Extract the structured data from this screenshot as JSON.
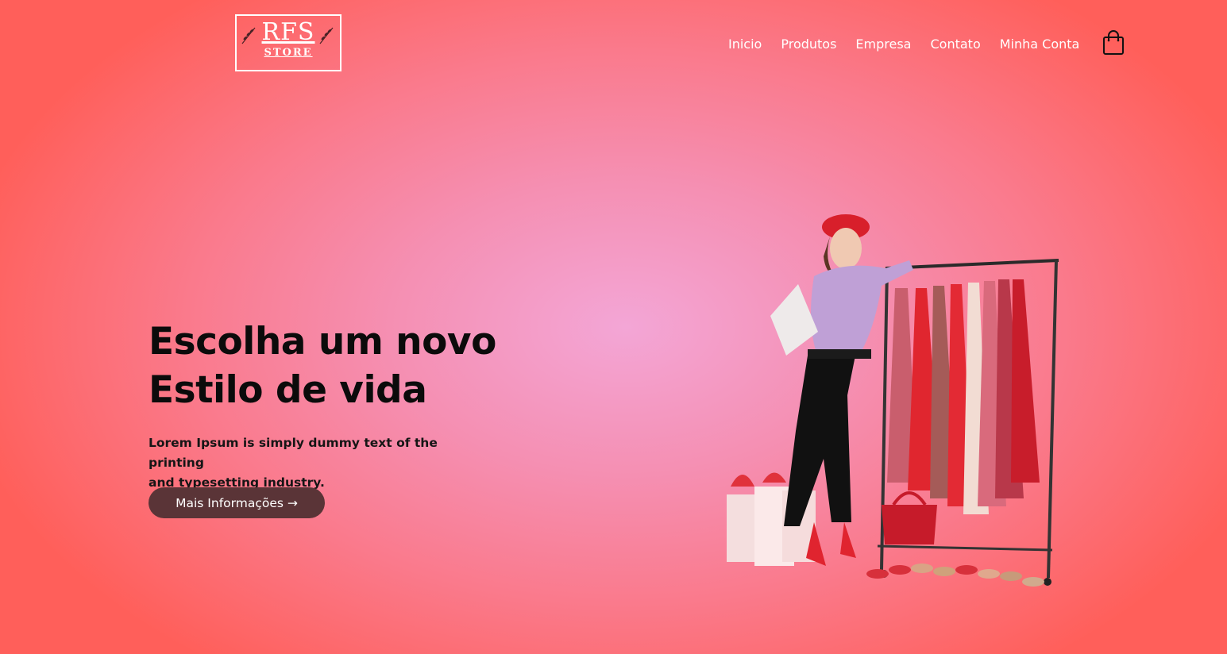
{
  "brand": {
    "logo_main": "RFS",
    "logo_sub": "STORE"
  },
  "nav": {
    "items": [
      "Inicio",
      "Produtos",
      "Empresa",
      "Contato",
      "Minha Conta"
    ]
  },
  "cart": {
    "icon": "shopping-bag-icon"
  },
  "hero": {
    "title_line1": "Escolha um novo",
    "title_line2": "Estilo de vida",
    "text_line1": "Lorem Ipsum is simply dummy text of the printing",
    "text_line2": "and typesetting industry.",
    "cta_label": "Mais Informações →"
  },
  "colors": {
    "cta_bg": "#5a3437",
    "accent_red": "#d81f2b",
    "text_dark": "#0b0b0b"
  }
}
